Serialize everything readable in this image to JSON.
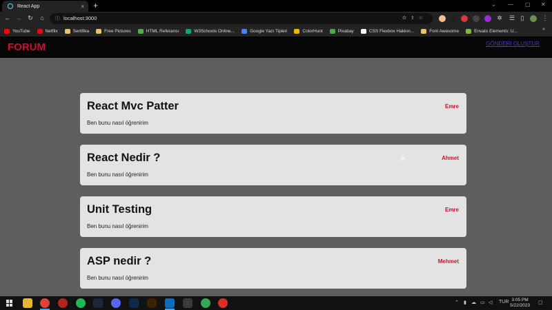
{
  "browser": {
    "tab_title": "React App",
    "tab_close": "×",
    "new_tab": "+",
    "url": "localhost:3000",
    "bookmarks": [
      {
        "label": "YouTube",
        "color": "#ff0000"
      },
      {
        "label": "Netflix",
        "color": "#e50914"
      },
      {
        "label": "Sertifika",
        "color": "#e8c36a"
      },
      {
        "label": "Free Pictures",
        "color": "#e8c36a"
      },
      {
        "label": "HTML Referansı",
        "color": "#4caf50"
      },
      {
        "label": "W3Schools Online...",
        "color": "#04aa6d"
      },
      {
        "label": "Google Yazı Tipleri",
        "color": "#4285f4"
      },
      {
        "label": "ColorHunt",
        "color": "#f4b400"
      },
      {
        "label": "Pixabay",
        "color": "#48a947"
      },
      {
        "label": "CSS Flexbox Hakkın...",
        "color": "#ffffff"
      },
      {
        "label": "Font Awesome",
        "color": "#e8c36a"
      },
      {
        "label": "Envato Elements: U...",
        "color": "#82b541"
      }
    ],
    "bookmarks_more": "»"
  },
  "navbar": {
    "logo": "FORUM",
    "create_link": "GÖNDERİ OLUŞTUR"
  },
  "posts": [
    {
      "title": "React Mvc Patter",
      "author": "Emre",
      "body": "Ben bunu nasıl öğrenirim"
    },
    {
      "title": "React Nedir ?",
      "author": "Ahmet",
      "body": "Ben bunu nasıl öğrenirim"
    },
    {
      "title": "Unit Testing",
      "author": "Emre",
      "body": "Ben bunu nasıl öğrenirim"
    },
    {
      "title": "ASP nedir ?",
      "author": "Mehmet",
      "body": "Ben bunu nasıl öğrenirim"
    }
  ],
  "taskbar": {
    "language": "TUR",
    "time": "3:05 PM",
    "date": "5/22/2023"
  },
  "colors": {
    "accent": "#c8102e",
    "link": "#4f3bd1",
    "page_bg": "#5f5d5d",
    "card_bg": "#e4e3e4"
  }
}
